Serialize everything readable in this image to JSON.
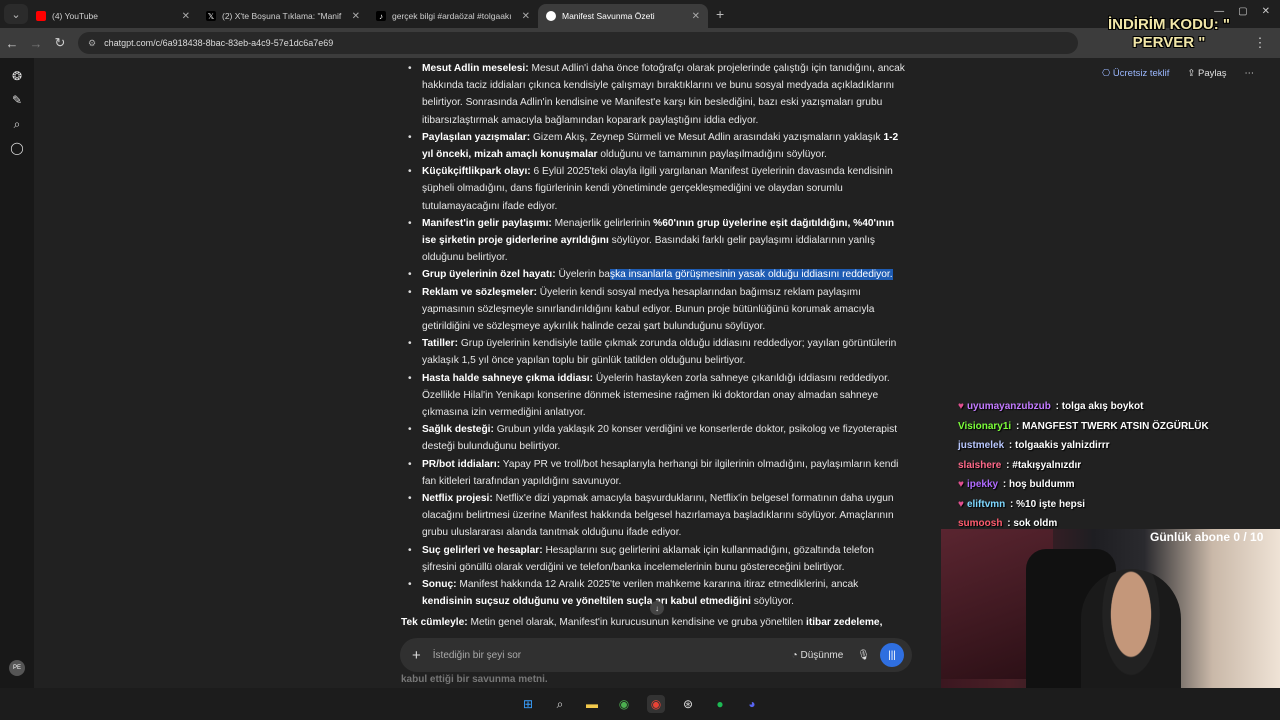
{
  "browser": {
    "tabs": [
      {
        "title": "(4) YouTube",
        "color": "#ff0000"
      },
      {
        "title": "(2) X'te Boşuna Tıklama: \"Manif",
        "color": "#000000"
      },
      {
        "title": "gerçek bilgi #ardaözal #tolgaakı",
        "color": "#000000"
      },
      {
        "title": "Manifest Savunma Özeti",
        "color": "#ffffff",
        "active": true
      }
    ],
    "url": "chatgpt.com/c/6a918438-8bac-83eb-a4c9-57e1dc6a7e69"
  },
  "header": {
    "offer_label": "Ücretsiz teklif",
    "share_label": "Paylaş"
  },
  "items": [
    {
      "title": "Mesut Adlin meselesi:",
      "text": " Mesut Adlin'i daha önce fotoğrafçı olarak projelerinde çalıştığı için tanıdığını, ancak hakkında taciz iddiaları çıkınca kendisiyle çalışmayı bıraktıklarını ve bunu sosyal medyada açıkladıklarını belirtiyor. Sonrasında Adlin'in kendisine ve Manifest'e karşı kin beslediğini, bazı eski yazışmaları grubu itibarsızlaştırmak amacıyla bağlamından koparark paylaştığını iddia ediyor."
    },
    {
      "title": "Paylaşılan yazışmalar:",
      "text": " Gizem Akış, Zeynep Sürmeli ve Mesut Adlin arasındaki yazışmaların yaklaşık ",
      "bold2": "1-2 yıl önceki, mizah amaçlı konuşmalar",
      "text2": " olduğunu ve tamamının paylaşılmadığını söylüyor."
    },
    {
      "title": "Küçükçiftlikpark olayı:",
      "text": " 6 Eylül 2025'teki olayla ilgili yargılanan Manifest üyelerinin davasında kendisinin şüpheli olmadığını, dans figürlerinin kendi yönetiminde gerçekleşmediğini ve olaydan sorumlu tutulamayacağını ifade ediyor."
    },
    {
      "title": "Manifest'in gelir paylaşımı:",
      "text": " Menajerlik gelirlerinin ",
      "bold2": "%60'ının grup üyelerine eşit dağıtıldığını, %40'ının ise şirketin proje giderlerine ayrıldığını",
      "text2": " söylüyor. Basındaki farklı gelir paylaşımı iddialarının yanlış olduğunu belirtiyor."
    },
    {
      "title": "Grup üyelerinin özel hayatı:",
      "text": " Üyelerin ba",
      "highlight": "şka insanlarla görüşmesinin yasak olduğu iddiasını reddediyor."
    },
    {
      "title": "Reklam ve sözleşmeler:",
      "text": " Üyelerin kendi sosyal medya hesaplarından bağımsız reklam paylaşımı yapmasının sözleşmeyle sınırlandırıldığını kabul ediyor. Bunun proje bütünlüğünü korumak amacıyla getirildiğini ve sözleşmeye aykırılık halinde cezai şart bulunduğunu söylüyor."
    },
    {
      "title": "Tatiller:",
      "text": " Grup üyelerinin kendisiyle tatile çıkmak zorunda olduğu iddiasını reddediyor; yayılan görüntülerin yaklaşık 1,5 yıl önce yapılan toplu bir günlük tatilden olduğunu belirtiyor."
    },
    {
      "title": "Hasta halde sahneye çıkma iddiası:",
      "text": " Üyelerin hastayken zorla sahneye çıkarıldığı iddiasını reddediyor. Özellikle Hilal'in Yenikapı konserine dönmek istemesine rağmen iki doktordan onay almadan sahneye çıkmasına izin vermediğini anlatıyor."
    },
    {
      "title": "Sağlık desteği:",
      "text": " Grubun yılda yaklaşık 20 konser verdiğini ve konserlerde doktor, psikolog ve fizyoterapist desteği bulunduğunu belirtiyor."
    },
    {
      "title": "PR/bot iddiaları:",
      "text": " Yapay PR ve troll/bot hesaplarıyla herhangi bir ilgilerinin olmadığını, paylaşımların kendi fan kitleleri tarafından yapıldığını savunuyor."
    },
    {
      "title": "Netflix projesi:",
      "text": " Netflix'e dizi yapmak amacıyla başvurduklarını, Netflix'in belgesel formatının daha uygun olacağını belirtmesi üzerine Manifest hakkında belgesel hazırlamaya başladıklarını söylüyor. Amaçlarının grubu uluslararası alanda tanıtmak olduğunu ifade ediyor."
    },
    {
      "title": "Suç gelirleri ve hesaplar:",
      "text": " Hesaplarını suç gelirlerini aklamak için kullanmadığını, gözaltında telefon şifresini gönüllü olarak verdiğini ve telefon/banka incelemelerinin bunu göstereceğini belirtiyor."
    },
    {
      "title": "Sonuç:",
      "text": " Manifest hakkında 12 Aralık 2025'te verilen mahkeme kararına itiraz etmediklerini, ancak ",
      "bold2": "kendisinin suçsuz olduğunu ve yöneltilen suçla   arı kabul etmediğini",
      "text2": " söylüyor."
    }
  ],
  "summary": {
    "title": "Tek cümleyle:",
    "text": " Metin genel olarak, Manifest'in kurucusunun kendisine ve gruba yöneltilen ",
    "bold2": "itibar zedeleme,"
  },
  "below_text": "kabul ettiği bir savunma metni.",
  "composer": {
    "placeholder": "İstediğin bir şeyi sor",
    "think_label": "Düşünme"
  },
  "stream": {
    "promo": "İNDİRİM KODU: \" PERVER \"",
    "subs": "Günlük abone 0 / 10",
    "chat": [
      {
        "user": "uyumayanzubzub",
        "color": "#c37bff",
        "heart": true,
        "text": " : tolga akış boykot"
      },
      {
        "user": "Visionary1i",
        "color": "#7cff3a",
        "heart": false,
        "text": " : MANGFEST TWERK ATSIN ÖZGÜRLÜK"
      },
      {
        "user": "justmelek",
        "color": "#b9c8ff",
        "heart": false,
        "text": " : tolgaakis yalnizdirrr"
      },
      {
        "user": "slaishere",
        "color": "#ff6a8a",
        "heart": false,
        "text": " : #takışyalnızdır"
      },
      {
        "user": "ipekky",
        "color": "#b06bff",
        "heart": true,
        "text": " : hoş buldumm"
      },
      {
        "user": "eliftvmn",
        "color": "#7fd8ff",
        "heart": true,
        "text": " : %10 işte hepsi"
      },
      {
        "user": "sumoosh",
        "color": "#ff5b6e",
        "heart": false,
        "text": " : sok oldm"
      }
    ]
  },
  "avatar_initials": "PE"
}
